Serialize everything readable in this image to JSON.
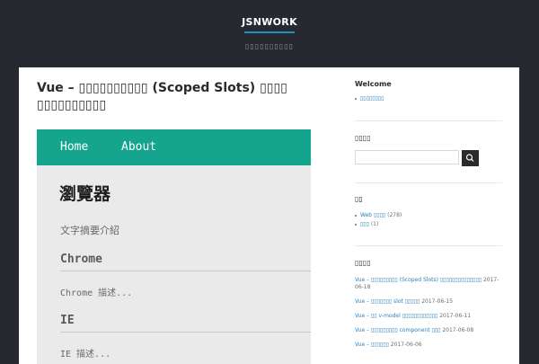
{
  "site": {
    "title": "JSNWORK",
    "tagline": "▯▯▯▯▯▯▯▯▯▯"
  },
  "post": {
    "title": "Vue – ▯▯▯▯▯▯▯▯▯▯ (Scoped Slots) ▯▯▯▯ ▯▯▯▯▯▯▯▯▯▯"
  },
  "demo": {
    "nav": [
      "Home",
      "About"
    ],
    "heading": "瀏覽器",
    "description": "文字摘要介紹",
    "items": [
      {
        "title": "Chrome",
        "desc": "Chrome 描述..."
      },
      {
        "title": "IE",
        "desc": "IE 描述..."
      }
    ]
  },
  "sidebar": {
    "welcome": {
      "title": "Welcome",
      "link": "▯▯▯▯▯▯▯▯"
    },
    "search": {
      "title": "▯▯▯▯",
      "placeholder": ""
    },
    "categories": {
      "title": "▯▯",
      "items": [
        {
          "label": "Web ▯▯▯▯",
          "count": "(278)"
        },
        {
          "label": "▯▯▯",
          "count": "(1)"
        }
      ]
    },
    "recent": {
      "title": "▯▯▯▯",
      "items": [
        {
          "text": "Vue – ▯▯▯▯▯▯▯▯▯ (Scoped Slots) ▯▯▯▯▯▯▯▯▯▯▯▯▯▯",
          "date": "2017-06-18"
        },
        {
          "text": "Vue – ▯▯▯▯▯▯▯ slot ▯▯▯▯▯",
          "date": "2017-06-15"
        },
        {
          "text": "Vue – ▯▯ v-model ▯▯▯▯▯▯▯▯▯▯▯▯",
          "date": "2017-06-11"
        },
        {
          "text": "Vue – ▯▯▯▯▯▯▯▯▯ component ▯▯▯",
          "date": "2017-06-08"
        },
        {
          "text": "Vue – ▯▯▯▯▯▯",
          "date": "2017-06-06"
        }
      ]
    }
  },
  "colors": {
    "page_background": "#262a30",
    "accent_link": "#2a83bb",
    "demo_nav": "#15a58f"
  },
  "icons": {
    "search_button": "search-icon"
  }
}
